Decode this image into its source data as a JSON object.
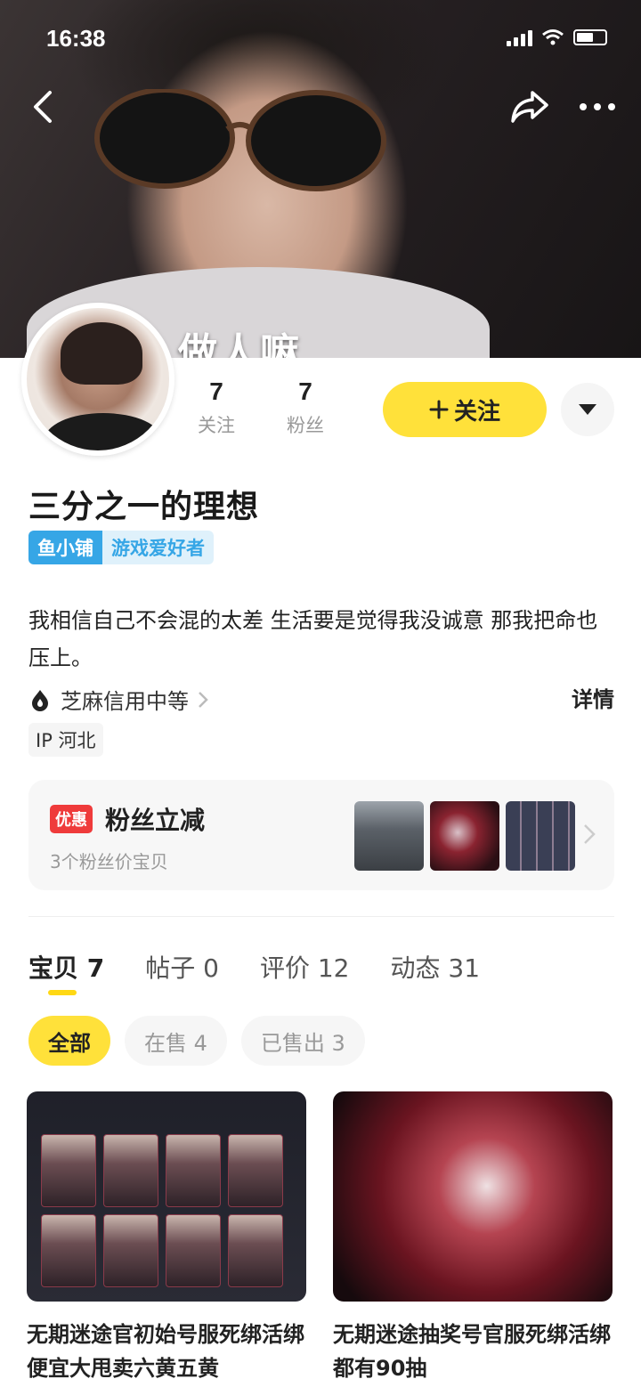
{
  "status_bar": {
    "time": "16:38"
  },
  "cover": {
    "caption": "做人嘛"
  },
  "profile": {
    "stats": [
      {
        "num": "7",
        "label": "关注"
      },
      {
        "num": "7",
        "label": "粉丝"
      }
    ],
    "follow_label": "关注",
    "username": "三分之一的理想",
    "badge_shop": "鱼小铺",
    "badge_tag": "游戏爱好者",
    "bio": "我相信自己不会混的太差 生活要是觉得我没诚意 那我把命也压上。",
    "credit": "芝麻信用中等",
    "detail": "详情",
    "ip": "IP 河北"
  },
  "promo": {
    "badge": "优惠",
    "title": "粉丝立减",
    "subtitle": "3个粉丝价宝贝"
  },
  "tabs": [
    {
      "label": "宝贝 7"
    },
    {
      "label": "帖子 0"
    },
    {
      "label": "评价 12"
    },
    {
      "label": "动态 31"
    }
  ],
  "filters": [
    {
      "label": "全部"
    },
    {
      "label": "在售 4"
    },
    {
      "label": "已售出 3"
    }
  ],
  "products": [
    {
      "name": "无期迷途官初始号服死绑活绑便宜大甩卖六黄五黄"
    },
    {
      "name": "无期迷途抽奖号官服死绑活绑都有90抽"
    }
  ],
  "colors": {
    "accent_yellow": "#ffe13a",
    "badge_blue": "#36a6e6",
    "promo_red": "#ef3b3b"
  }
}
